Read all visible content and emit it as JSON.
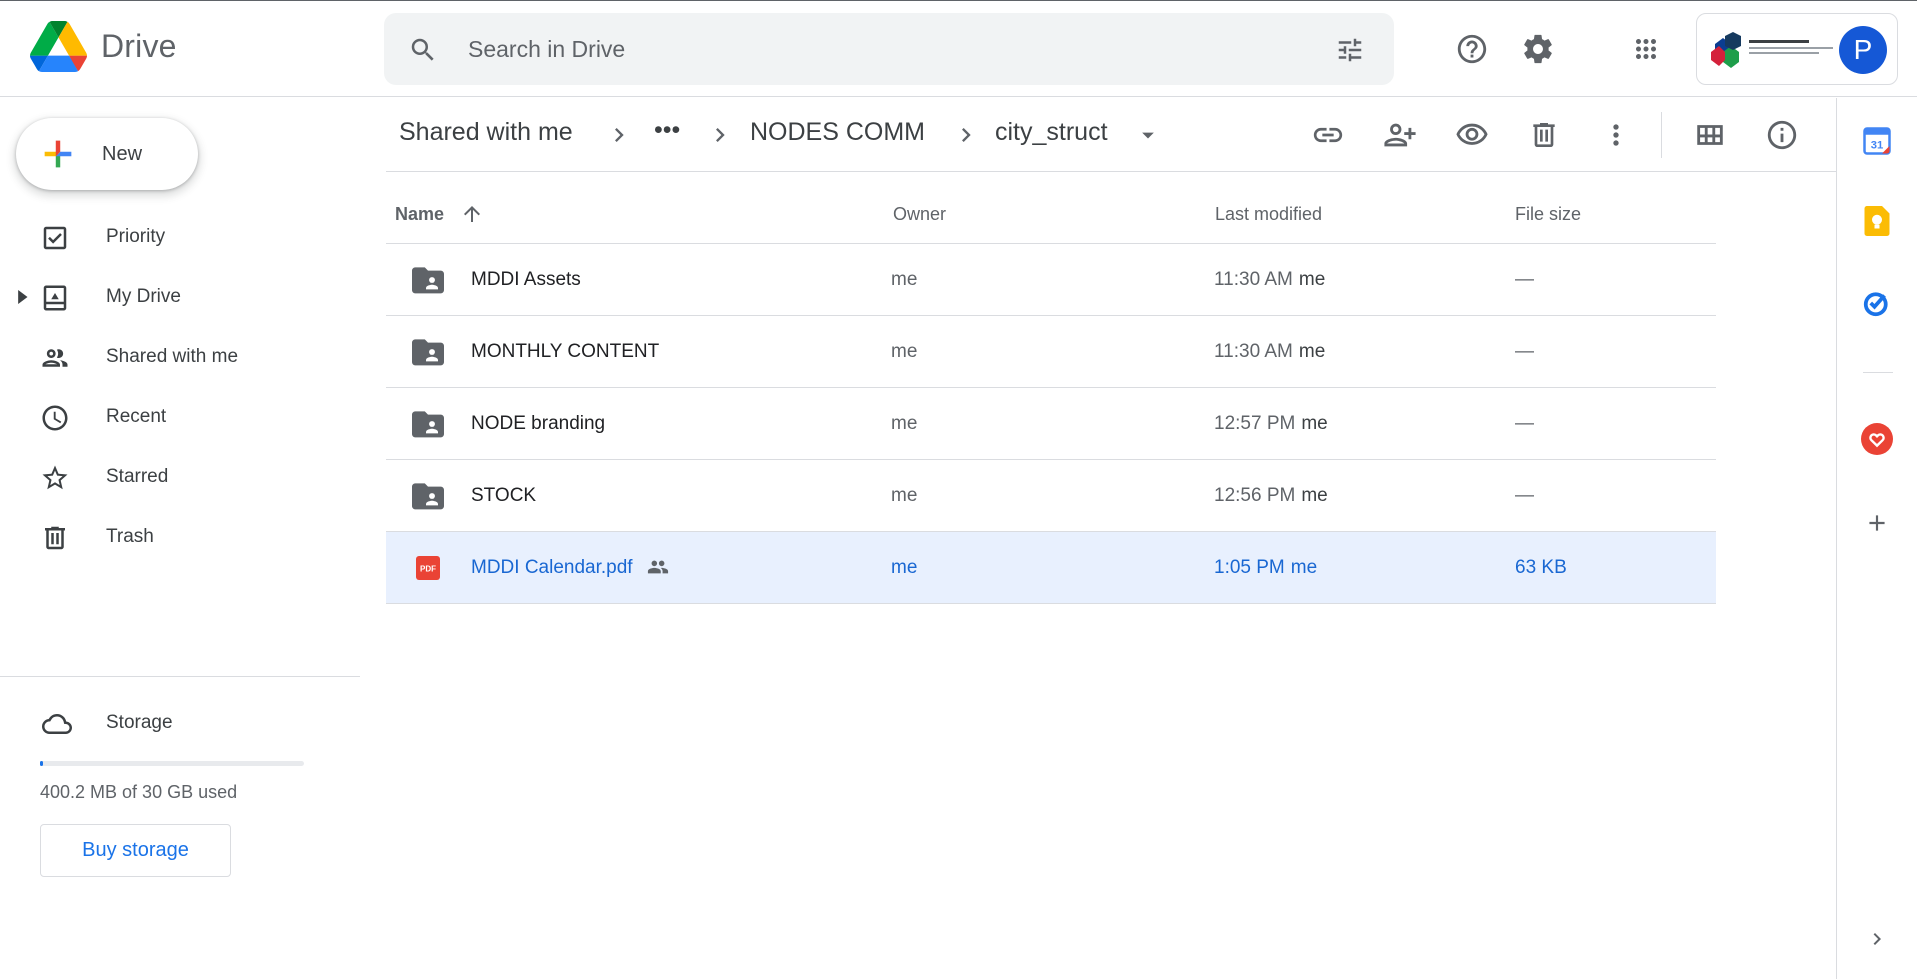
{
  "app": {
    "name": "Drive"
  },
  "search": {
    "placeholder": "Search in Drive"
  },
  "account": {
    "avatar_letter": "P",
    "org_logo_text": "Fab City Global Initiative"
  },
  "sidebar": {
    "new_label": "New",
    "items": [
      {
        "label": "Priority",
        "icon": "priority-check-icon"
      },
      {
        "label": "My Drive",
        "icon": "my-drive-icon"
      },
      {
        "label": "Shared with me",
        "icon": "people-icon"
      },
      {
        "label": "Recent",
        "icon": "clock-icon"
      },
      {
        "label": "Starred",
        "icon": "star-icon"
      },
      {
        "label": "Trash",
        "icon": "trash-icon"
      }
    ],
    "storage": {
      "label": "Storage",
      "used_text": "400.2 MB of 30 GB used",
      "used_fraction": 0.013,
      "buy_label": "Buy storage"
    }
  },
  "breadcrumb": {
    "items": [
      "Shared with me",
      "•••",
      "NODES COMM",
      "city_struct"
    ]
  },
  "table": {
    "headers": {
      "name": "Name",
      "owner": "Owner",
      "modified": "Last modified",
      "size": "File size"
    },
    "rows": [
      {
        "name": "MDDI Assets",
        "type": "shared-folder",
        "owner": "me",
        "modified": "11:30 AM",
        "modified_by": "me",
        "size": "—"
      },
      {
        "name": "MONTHLY CONTENT",
        "type": "shared-folder",
        "owner": "me",
        "modified": "11:30 AM",
        "modified_by": "me",
        "size": "—"
      },
      {
        "name": "NODE branding",
        "type": "shared-folder",
        "owner": "me",
        "modified": "12:57 PM",
        "modified_by": "me",
        "size": "—"
      },
      {
        "name": "STOCK",
        "type": "shared-folder",
        "owner": "me",
        "modified": "12:56 PM",
        "modified_by": "me",
        "size": "—"
      },
      {
        "name": "MDDI Calendar.pdf",
        "type": "pdf",
        "owner": "me",
        "modified": "1:05 PM",
        "modified_by": "me",
        "size": "63 KB",
        "selected": true,
        "pdf_badge": "PDF"
      }
    ]
  },
  "rail": {
    "calendar_day": "31"
  },
  "colors": {
    "accent": "#1a73e8",
    "selected_row": "#e8f0fe",
    "pdf_red": "#ea4335"
  }
}
